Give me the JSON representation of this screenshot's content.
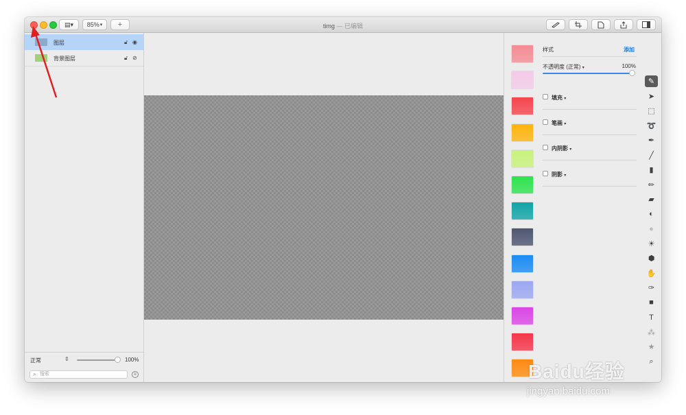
{
  "window": {
    "app_title": "timg",
    "title_separator": "—",
    "edited_label": "已编辑",
    "zoom": "85%",
    "add_label": "+"
  },
  "layers": [
    {
      "name": "图层",
      "color": "#8da9cc",
      "selected": true
    },
    {
      "name": "背景图层",
      "color": "#9fd37a",
      "selected": false
    }
  ],
  "blend": {
    "mode": "正常",
    "opacity": "100%"
  },
  "search": {
    "placeholder": "搜索"
  },
  "styles": {
    "title": "样式",
    "add_label": "添加",
    "opacity_label": "不透明度 (正常)",
    "opacity_value": "100%",
    "effects": [
      "填充",
      "笔画",
      "内阴影",
      "阴影"
    ]
  },
  "swatches": [
    "#f58c94",
    "#f4cbe8",
    "#f5454d",
    "#ffb40e",
    "#c8f27c",
    "#2ee34e",
    "#10a4a8",
    "#4e5670",
    "#1a8cf4",
    "#9ca8f2",
    "#da47e6",
    "#f5364a",
    "#ff8a10"
  ],
  "tools": [
    "style-brush-icon",
    "pointer-icon",
    "rect-select-icon",
    "lasso-icon",
    "color-picker-icon",
    "paint-brush-icon",
    "paint-bucket-icon",
    "pencil-icon",
    "eraser-icon",
    "smudge-icon",
    "blur-icon",
    "dodge-icon",
    "burn-icon",
    "clone-icon",
    "pen-icon",
    "shape-icon",
    "text-icon",
    "color-adjust-icon",
    "star-icon",
    "zoom-icon"
  ],
  "watermark": {
    "brand": "Baidu经验",
    "url": "jingyan.baidu.com"
  }
}
